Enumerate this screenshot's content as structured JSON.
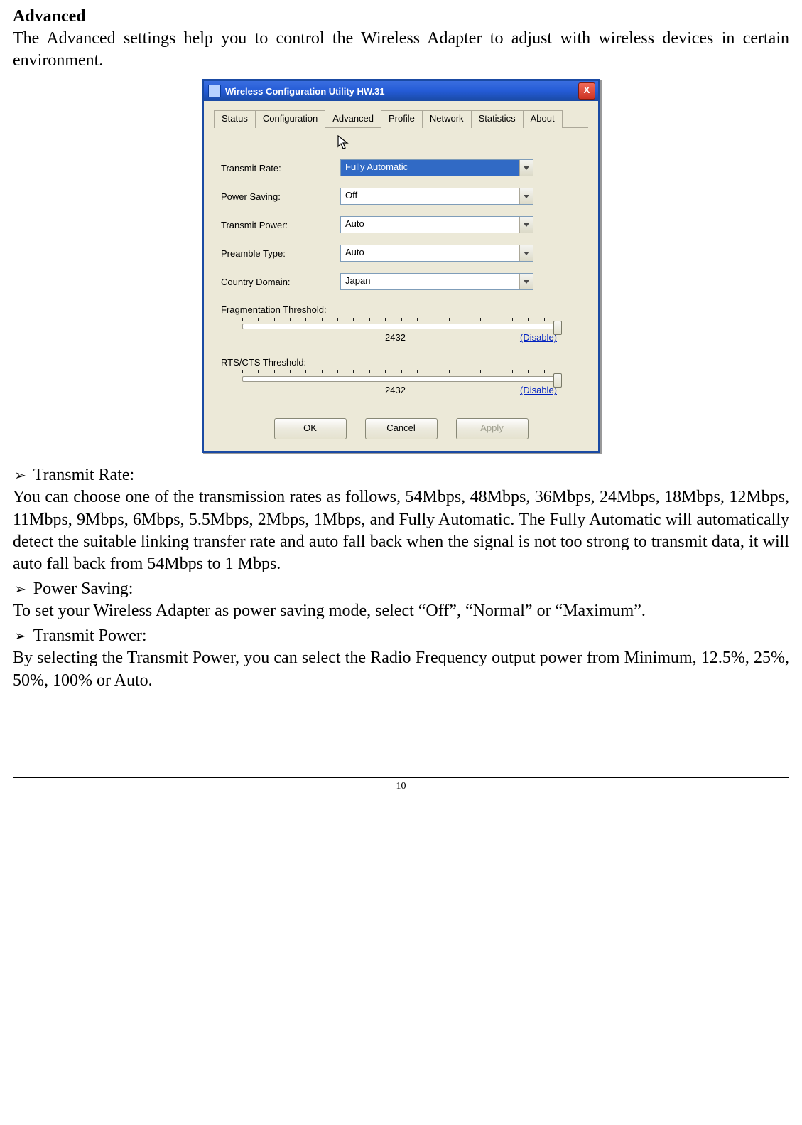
{
  "heading": "Advanced",
  "intro": "The Advanced settings help you to control the Wireless Adapter to adjust with wireless devices in certain environment.",
  "window": {
    "title": "Wireless Configuration Utility HW.31",
    "close_label": "X",
    "tabs": [
      "Status",
      "Configuration",
      "Advanced",
      "Profile",
      "Network",
      "Statistics",
      "About"
    ],
    "active_tab": "Advanced",
    "fields": {
      "transmit_rate": {
        "label": "Transmit Rate:",
        "value": "Fully Automatic"
      },
      "power_saving": {
        "label": "Power Saving:",
        "value": "Off"
      },
      "transmit_power": {
        "label": "Transmit Power:",
        "value": "Auto"
      },
      "preamble_type": {
        "label": "Preamble Type:",
        "value": "Auto"
      },
      "country_domain": {
        "label": "Country Domain:",
        "value": "Japan"
      }
    },
    "frag": {
      "label": "Fragmentation Threshold:",
      "value": "2432",
      "link": "(Disable)"
    },
    "rts": {
      "label": "RTS/CTS Threshold:",
      "value": "2432",
      "link": "(Disable)"
    },
    "buttons": {
      "ok": "OK",
      "cancel": "Cancel",
      "apply": "Apply"
    }
  },
  "sections": [
    {
      "title": "Transmit Rate:",
      "body": "You can choose one of the transmission rates as follows, 54Mbps, 48Mbps, 36Mbps, 24Mbps, 18Mbps, 12Mbps, 11Mbps, 9Mbps, 6Mbps, 5.5Mbps, 2Mbps, 1Mbps, and Fully Automatic. The Fully Automatic will automatically detect the suitable linking transfer rate and auto fall back when the signal is not too strong to transmit data, it will auto fall back from 54Mbps to 1 Mbps."
    },
    {
      "title": "Power Saving:",
      "body": "To set your Wireless Adapter as power saving mode, select “Off”, “Normal” or “Maximum”."
    },
    {
      "title": "Transmit Power:",
      "body": "By selecting the Transmit Power, you can select the Radio Frequency output power from Minimum, 12.5%, 25%, 50%, 100% or Auto."
    }
  ],
  "page_number": "10",
  "bullet_symbol": "➢"
}
